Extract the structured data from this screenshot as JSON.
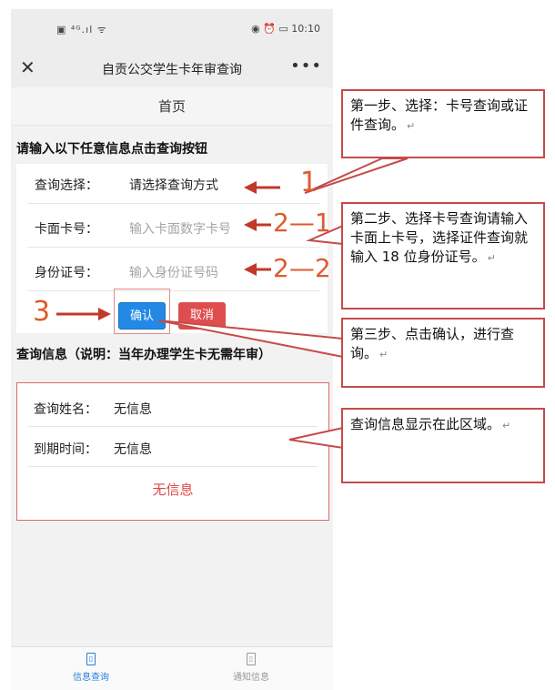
{
  "status_bar": {
    "left_icons": "▣ ⁴ᴳ.ıl ᯤ",
    "right_icons": "◉ ⏰ ▭",
    "time": "10:10"
  },
  "nav_bar": {
    "close_icon": "close-icon",
    "title": "自贡公交学生卡年审查询",
    "more_icon": "more-icon"
  },
  "home_tab": {
    "label": "首页"
  },
  "form": {
    "prompt": "请输入以下任意信息点击查询按钮",
    "query_type": {
      "label": "查询选择：",
      "value": "请选择查询方式"
    },
    "card_number": {
      "label": "卡面卡号：",
      "placeholder": "输入卡面数字卡号"
    },
    "id_number": {
      "label": "身份证号：",
      "placeholder": "输入身份证号码"
    },
    "confirm_button": "确认",
    "cancel_button": "取消"
  },
  "info": {
    "title": "查询信息（说明：当年办理学生卡无需年审）",
    "name": {
      "label": "查询姓名：",
      "value": "无信息"
    },
    "expiry": {
      "label": "到期时间：",
      "value": "无信息"
    },
    "result": "无信息"
  },
  "tab_bar": {
    "items": [
      {
        "label": "信息查询",
        "icon": "info-query-icon",
        "active": true
      },
      {
        "label": "通知信息",
        "icon": "notification-icon",
        "active": false
      }
    ],
    "active_color": "#2a7ddb"
  },
  "annotations": {
    "step1": "第一步、选择：卡号查询或证件查询。",
    "step2": "第二步、选择卡号查询请输入卡面上卡号，选择证件查询就输入 18 位身份证号。",
    "step3": "第三步、点击确认，进行查询。",
    "step4": "查询信息显示在此区域。",
    "markers": {
      "m1": "1",
      "m21": "2—1",
      "m22": "2—2",
      "m3": "3"
    },
    "enter_mark": "↵",
    "accent_color": "#c64a4a",
    "arrow_color": "#c0392b"
  }
}
